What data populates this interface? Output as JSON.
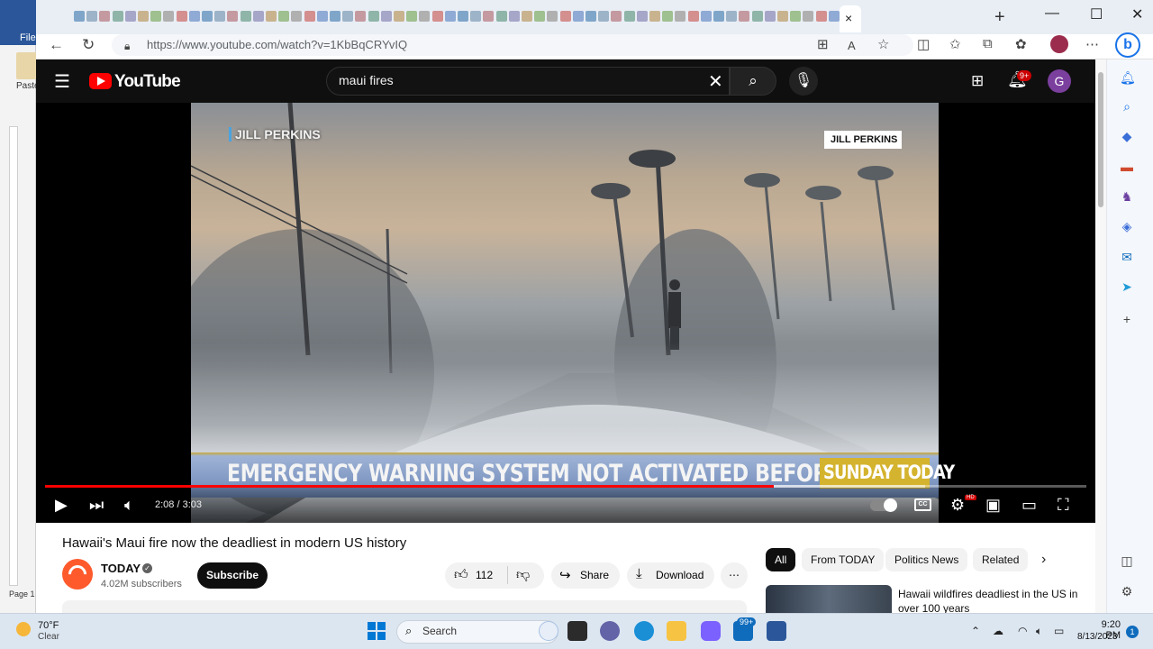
{
  "word": {
    "file_label": "File",
    "paste_label": "Paste",
    "page_label": "Page 1"
  },
  "browser": {
    "url": "https://www.youtube.com/watch?v=1KbBqCRYvIQ",
    "tab_close": "×",
    "new_tab": "+",
    "window_controls": {
      "minimize": "—",
      "maximize": "☐",
      "close": "✕"
    }
  },
  "youtube": {
    "logo_text": "YouTube",
    "search_query": "maui fires",
    "notification_count": "9+",
    "avatar_letter": "G",
    "video": {
      "overlay_name_left": "JILL PERKINS",
      "overlay_name_right": "JILL PERKINS",
      "headline": "EMERGENCY WARNING SYSTEM NOT ACTIVATED BEFORE FIRE",
      "show_logo": "SUNDAY TODAY",
      "time_display": "2:08 / 3:03",
      "progress_fraction": 0.7,
      "buffered_fraction": 0.845
    },
    "title": "Hawaii's Maui fire now the deadliest in modern US history",
    "channel": {
      "name": "TODAY",
      "subscribers": "4.02M subscribers",
      "subscribe_label": "Subscribe"
    },
    "actions": {
      "like_count": "112",
      "share_label": "Share",
      "download_label": "Download"
    },
    "chips": [
      "All",
      "From TODAY",
      "Politics News",
      "Related"
    ],
    "recommended": {
      "title": "Hawaii wildfires deadliest in the US in over 100 years"
    }
  },
  "taskbar": {
    "temperature": "70°F",
    "condition": "Clear",
    "search_label": "Search",
    "mail_badge": "99+",
    "time": "9:20 PM",
    "date": "8/13/2023",
    "notification_count": "1"
  },
  "colors": {
    "yt_red": "#ff0000",
    "yt_dark": "#0f0f0f",
    "edge_accent": "#1a73e8"
  }
}
